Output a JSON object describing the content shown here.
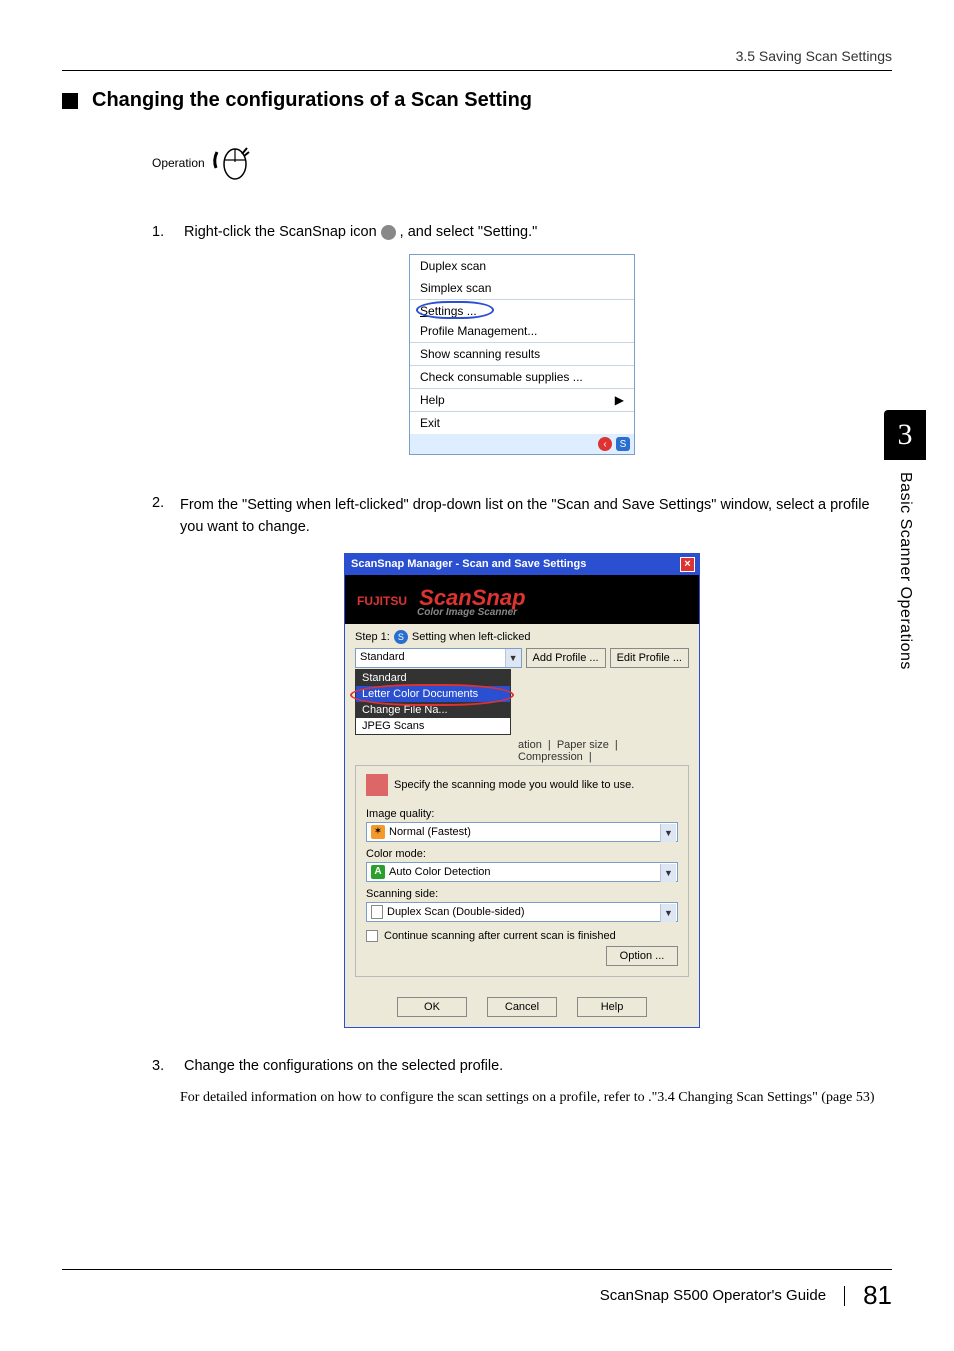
{
  "header": {
    "breadcrumb": "3.5 Saving Scan Settings"
  },
  "section": {
    "title": "Changing the configurations of a Scan Setting",
    "operation_label": "Operation"
  },
  "steps": {
    "s1_num": "1.",
    "s1_a": "Right-click the ScanSnap icon ",
    "s1_b": " , and select \"Setting.\"",
    "s2_num": "2.",
    "s2_text": "From the \"Setting when left-clicked\" drop-down list on the \"Scan and Save Settings\" window, select a profile you want to change.",
    "s3_num": "3.",
    "s3_text": "Change the configurations on the selected profile.",
    "s3_desc": "For detailed information on how to configure the scan settings on a profile, refer to .\"3.4 Changing Scan Settings\" (page 53)"
  },
  "context_menu": {
    "duplex": "Duplex scan",
    "simplex": "Simplex scan",
    "settings": "Settings ...",
    "profile_mgmt": "Profile Management...",
    "show_results": "Show scanning results",
    "consumables": "Check consumable supplies ...",
    "help": "Help",
    "exit": "Exit"
  },
  "scan_window": {
    "title": "ScanSnap Manager - Scan and Save Settings",
    "brand": "FUJITSU",
    "logo": "ScanSnap",
    "logo_sub": "Color Image Scanner",
    "step_label": "Step 1:",
    "step_name": "Setting when left-clicked",
    "profile_selected": "Standard",
    "add_profile": "Add Profile ...",
    "edit_profile": "Edit Profile ...",
    "dropdown": {
      "o1": "Standard",
      "o2": "Letter Color Documents",
      "o3": "Change File Na...",
      "o4": "JPEG Scans"
    },
    "tabs": {
      "t1": "ation",
      "t2": "Paper size",
      "t3": "Compression"
    },
    "instruct": "Specify the scanning mode you would like to use.",
    "iq_label": "Image quality:",
    "iq_value": "Normal (Fastest)",
    "cm_label": "Color mode:",
    "cm_value": "Auto Color Detection",
    "ss_label": "Scanning side:",
    "ss_value": "Duplex Scan (Double-sided)",
    "chk_label": "Continue scanning after current scan is finished",
    "option_btn": "Option ...",
    "ok": "OK",
    "cancel": "Cancel",
    "help": "Help"
  },
  "sidebar": {
    "chapter": "3",
    "title": "Basic Scanner Operations"
  },
  "footer": {
    "guide": "ScanSnap S500 Operator's Guide",
    "page": "81"
  }
}
